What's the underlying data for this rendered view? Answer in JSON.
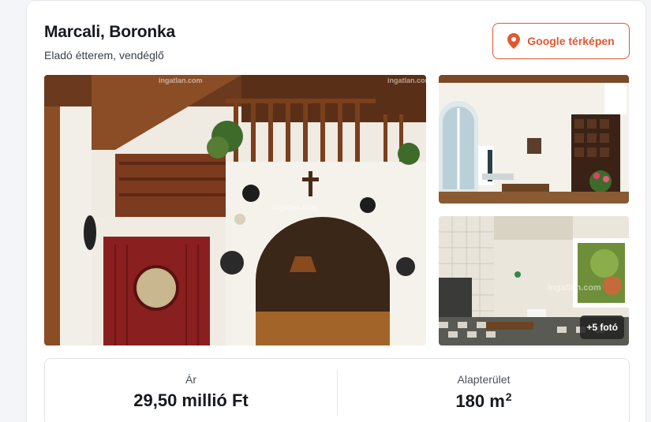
{
  "listing": {
    "title": "Marcali, Boronka",
    "subtitle": "Eladó étterem, vendéglő",
    "map_button_label": "Google térképen"
  },
  "gallery": {
    "watermark": "ingatlan.com",
    "more_photos_label": "+5 fotó"
  },
  "stats": {
    "price_label": "Ár",
    "price_value": "29,50 millió Ft",
    "area_label": "Alapterület",
    "area_value": "180 m",
    "area_unit_sup": "2"
  },
  "colors": {
    "accent": "#e4572e"
  },
  "icons": {
    "map_pin": "location-pin-icon"
  }
}
